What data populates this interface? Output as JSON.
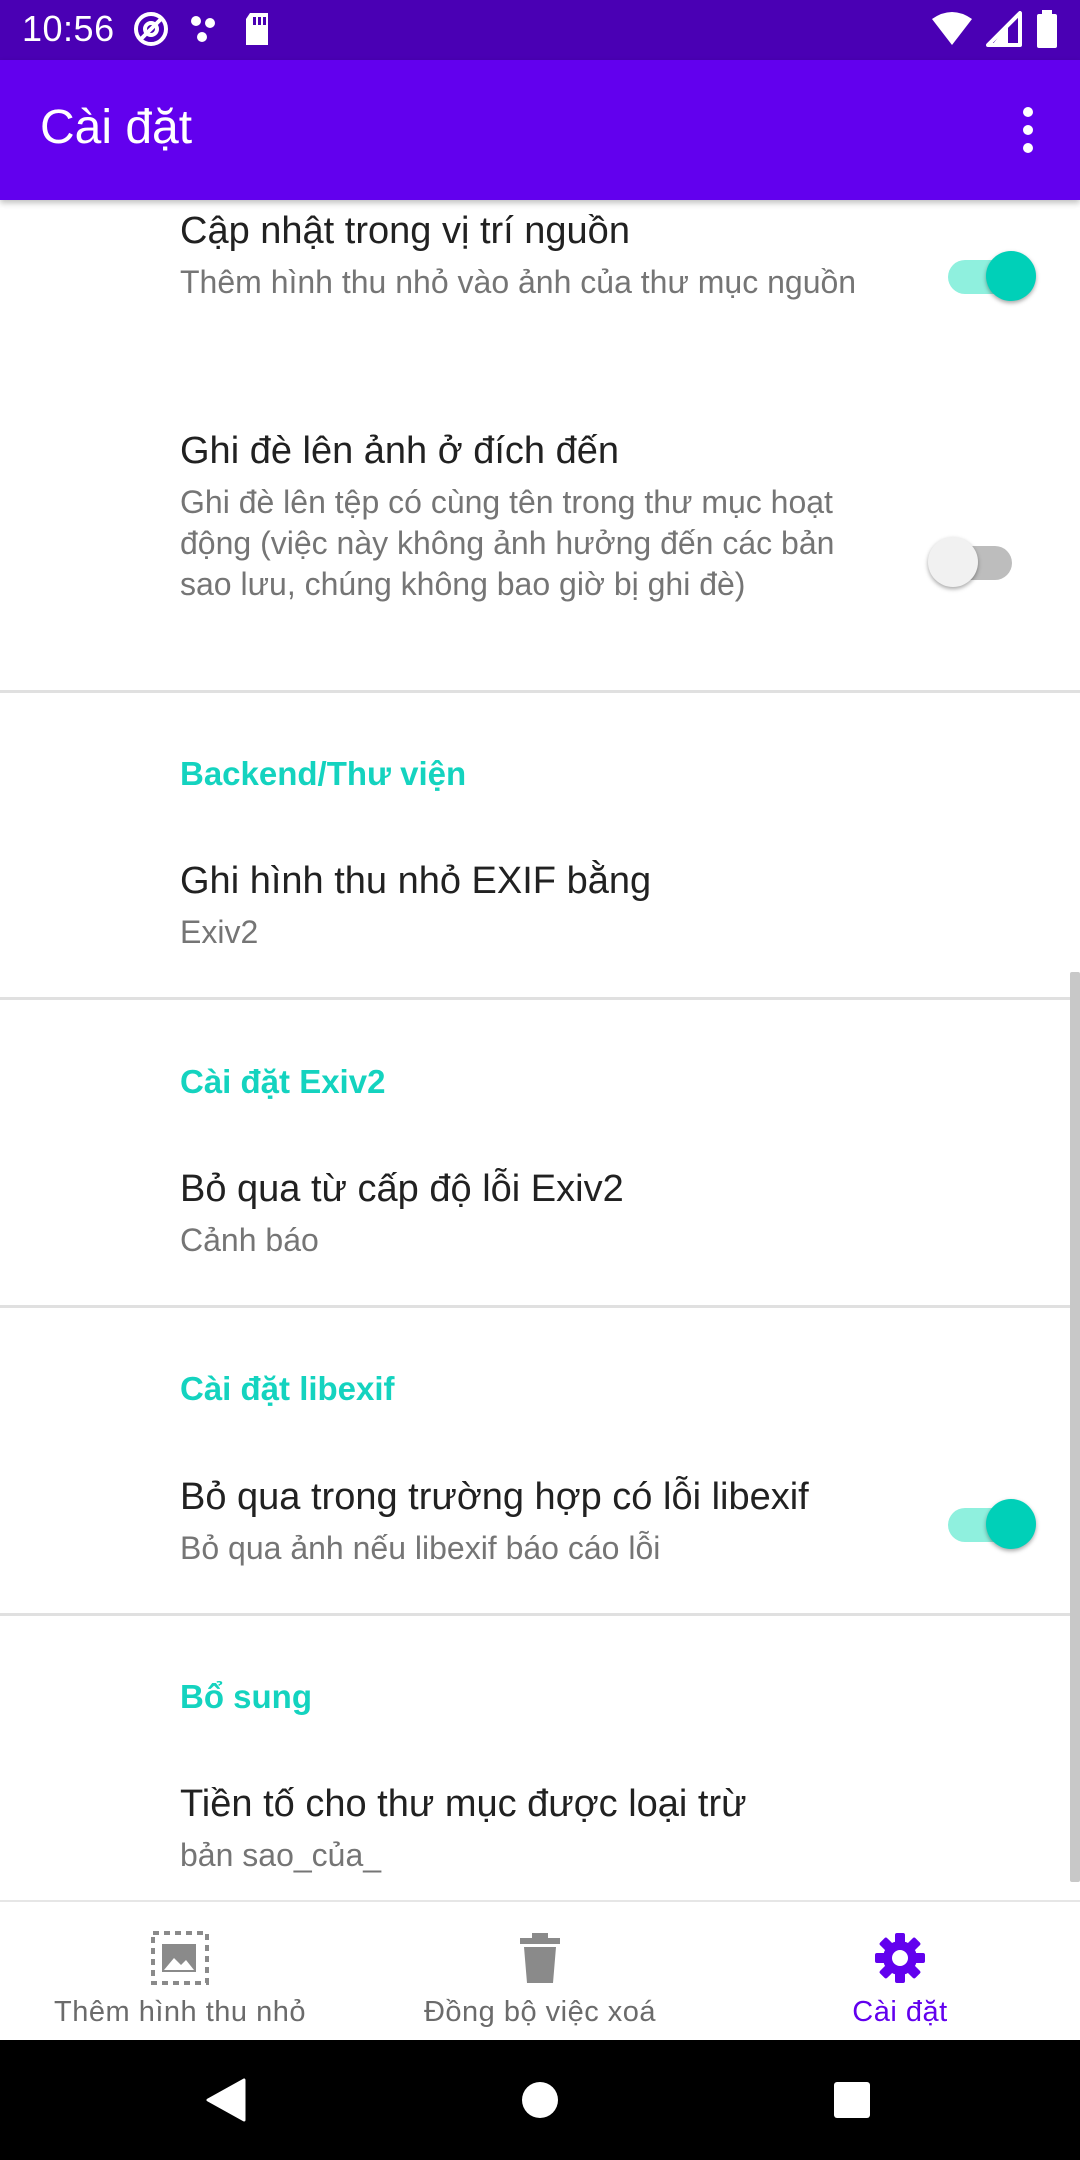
{
  "status_bar": {
    "time": "10:56",
    "left_icons": [
      "at-sign-icon",
      "dots-icon",
      "sd-card-icon"
    ],
    "right_icons": [
      "wifi-icon",
      "signal-icon",
      "battery-icon"
    ]
  },
  "app_bar": {
    "title": "Cài đặt",
    "menu_icon": "more-vert-icon"
  },
  "settings": {
    "update_in_source": {
      "title": "Cập nhật trong vị trí nguồn",
      "summary": "Thêm hình thu nhỏ vào ảnh của thư mục nguồn",
      "enabled": true
    },
    "overwrite_destination": {
      "title": "Ghi đè lên ảnh ở đích đến",
      "summary": "Ghi đè lên tệp có cùng tên trong thư mục hoạt động (việc này không ảnh hưởng đến các bản sao lưu, chúng không bao giờ bị ghi đè)",
      "enabled": false
    },
    "backend_category": "Backend/Thư viện",
    "exif_writer": {
      "title": "Ghi hình thu nhỏ EXIF bằng",
      "value": "Exiv2"
    },
    "exiv2_category": "Cài đặt Exiv2",
    "exiv2_skip_level": {
      "title": "Bỏ qua từ cấp độ lỗi Exiv2",
      "value": "Cảnh báo"
    },
    "libexif_category": "Cài đặt libexif",
    "libexif_skip": {
      "title": "Bỏ qua trong trường hợp có lỗi libexif",
      "summary": "Bỏ qua ảnh nếu libexif báo cáo lỗi",
      "enabled": true
    },
    "extra_category": "Bổ sung",
    "excluded_prefix": {
      "title": "Tiền tố cho thư mục được loại trừ",
      "value": "bản sao_của_"
    }
  },
  "bottom_nav": {
    "items": [
      {
        "label": "Thêm hình thu nhỏ",
        "icon": "add-thumbnail-icon",
        "active": false
      },
      {
        "label": "Đồng bộ việc xoá",
        "icon": "trash-icon",
        "active": false
      },
      {
        "label": "Cài đặt",
        "icon": "gear-icon",
        "active": true
      }
    ]
  },
  "colors": {
    "status_bar": "#4a00b4",
    "app_bar": "#6200ee",
    "accent": "#14d3bf",
    "nav_active": "#6200ee"
  }
}
